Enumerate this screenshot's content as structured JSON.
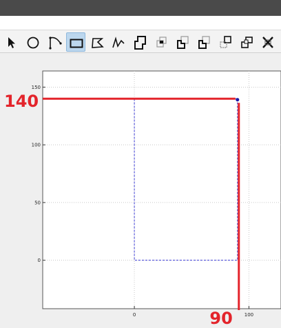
{
  "toolbar": {
    "active_tool": "rectangle",
    "tools": [
      {
        "name": "pointer",
        "icon": "arrow-pointer-icon"
      },
      {
        "name": "circle",
        "icon": "circle-icon"
      },
      {
        "name": "curve",
        "icon": "curve-icon"
      },
      {
        "name": "rectangle",
        "icon": "rectangle-icon"
      },
      {
        "name": "polygon",
        "icon": "polygon-icon"
      },
      {
        "name": "polyline",
        "icon": "polyline-icon"
      },
      {
        "name": "union",
        "icon": "union-icon"
      },
      {
        "name": "intersect",
        "icon": "intersect-icon"
      },
      {
        "name": "subtract",
        "icon": "subtract-icon"
      },
      {
        "name": "subtract-reverse",
        "icon": "subtract-reverse-icon"
      },
      {
        "name": "exclude",
        "icon": "exclude-icon"
      },
      {
        "name": "group",
        "icon": "group-icon"
      },
      {
        "name": "delete",
        "icon": "delete-x-icon"
      }
    ]
  },
  "chart_data": {
    "type": "scatter",
    "xlim": [
      -80,
      128
    ],
    "ylim": [
      -42,
      164
    ],
    "x_ticks": [
      0,
      100
    ],
    "y_ticks": [
      150,
      100,
      50,
      0
    ],
    "x_tick_labels": [
      "0",
      "100"
    ],
    "y_tick_labels": [
      "150",
      "100",
      "50",
      "0"
    ],
    "grid": true,
    "series": [
      {
        "points": [
          {
            "x": 90,
            "y": 140
          }
        ]
      }
    ],
    "shapes": [
      {
        "type": "rectangle",
        "style": "dashed",
        "color": "#3b3bd6",
        "x": [
          0,
          90
        ],
        "y": [
          0,
          140
        ]
      }
    ],
    "annotations": [
      {
        "text": "140",
        "value": 140,
        "axis": "y",
        "color": "#e3242b"
      },
      {
        "text": "90",
        "value": 90,
        "axis": "x",
        "color": "#e3242b"
      }
    ]
  }
}
